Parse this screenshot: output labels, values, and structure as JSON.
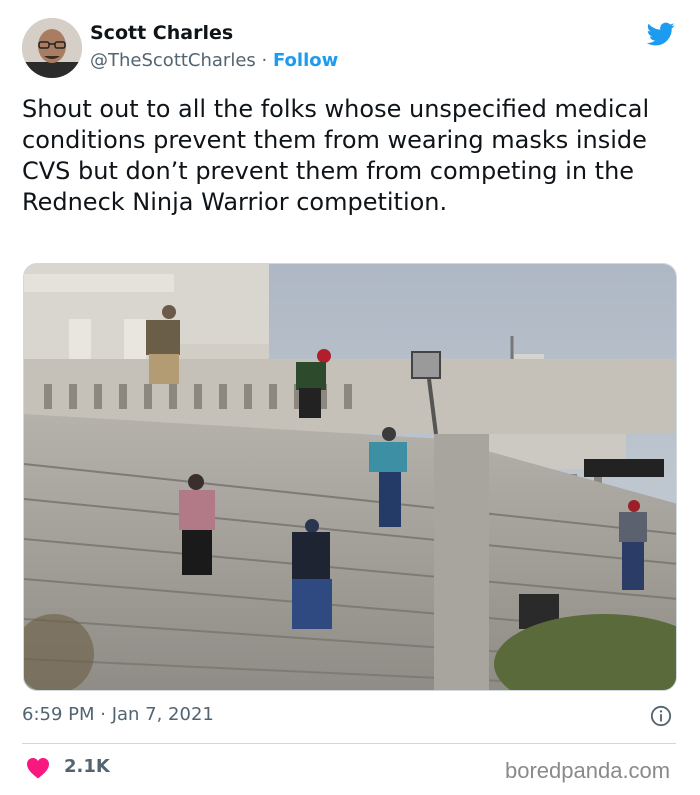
{
  "author": {
    "name": "Scott Charles",
    "handle": "@TheScottCharles",
    "separator": " · ",
    "follow_label": "Follow"
  },
  "tweet": {
    "text": "Shout out to all the folks whose unspecified medical conditions prevent them from wearing masks inside CVS but don’t prevent them from competing in the Redneck Ninja Warrior competition.",
    "timestamp": "6:59 PM · Jan 7, 2021",
    "likes": "2.1K"
  },
  "icons": {
    "brand": "twitter-bird-icon",
    "info": "info-icon",
    "like": "heart-icon"
  },
  "colors": {
    "accent": "#1d9bf0",
    "like": "#f91880",
    "muted": "#536471"
  },
  "watermark": "boredpanda.com"
}
